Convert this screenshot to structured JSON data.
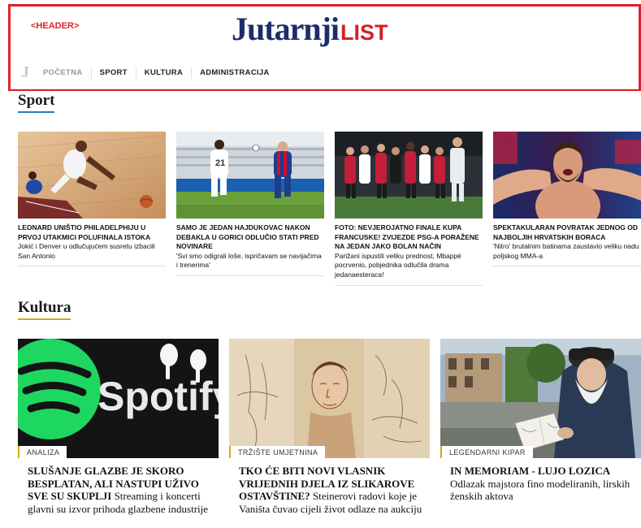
{
  "header": {
    "tag": "<HEADER>",
    "logo_main": "Jutarnji",
    "logo_sub": "LIST",
    "nav_letter": "J",
    "nav": [
      "POČETNA",
      "SPORT",
      "KULTURA",
      "ADMINISTRACIJA"
    ]
  },
  "sport": {
    "title": "Sport",
    "accent": "#2a7ab8",
    "cards": [
      {
        "headline": "LEONARD UNIŠTIO PHILADELPHIJU U PRVOJ UTAKMICI POLUFINALA ISTOKA",
        "sub": "Jokić i Denver u odlučujućem susretu izbacili San Antonio"
      },
      {
        "headline": "SAMO JE JEDAN HAJDUKOVAC NAKON DEBAKLA U GORICI ODLUČIO STATI PRED NOVINARE",
        "sub": "'Svi smo odigrali loše, ispričavam se navijačima i trenerima'"
      },
      {
        "headline": "FOTO: NEVJEROJATNO FINALE KUPA FRANCUSKE! ZVIJEZDE PSG-A PORAŽENE NA JEDAN JAKO BOLAN NAČIN",
        "sub": "Parižani ispustili veliku prednost, Mbappé pocrvenio, pobjednika odlučila drama jedanaesteraca!"
      },
      {
        "headline": "SPEKTAKULARAN POVRATAK JEDNOG OD NAJBOLJIH HRVATSKIH BORACA",
        "sub": "'Nitro' brutalnim batinama zaustavio veliku nadu poljskog MMA-a"
      }
    ]
  },
  "kultura": {
    "title": "Kultura",
    "accent": "#d9a516",
    "cards": [
      {
        "label": "ANALIZA",
        "headline": "SLUŠANJE GLAZBE JE SKORO BESPLATAN, ALI NASTUPI UŽIVO SVE SU SKUPLJI",
        "sub": "Streaming i koncerti glavni su izvor prihoda glazbene industrije",
        "img_text": "Spotify"
      },
      {
        "label": "TRŽIŠTE UMJETNINA",
        "headline": "TKO ĆE BITI NOVI VLASNIK VRIJEDNIH DJELA IZ SLIKAROVE OSTAVŠTINE?",
        "sub": "Steinerovi radovi koje je Vaništa čuvao cijeli život odlaze na aukciju"
      },
      {
        "label": "LEGENDARNI KIPAR",
        "headline": "IN MEMORIAM - LUJO LOZICA",
        "sub": "Odlazak majstora fino modeliranih, lirskih ženskih aktova"
      }
    ]
  }
}
